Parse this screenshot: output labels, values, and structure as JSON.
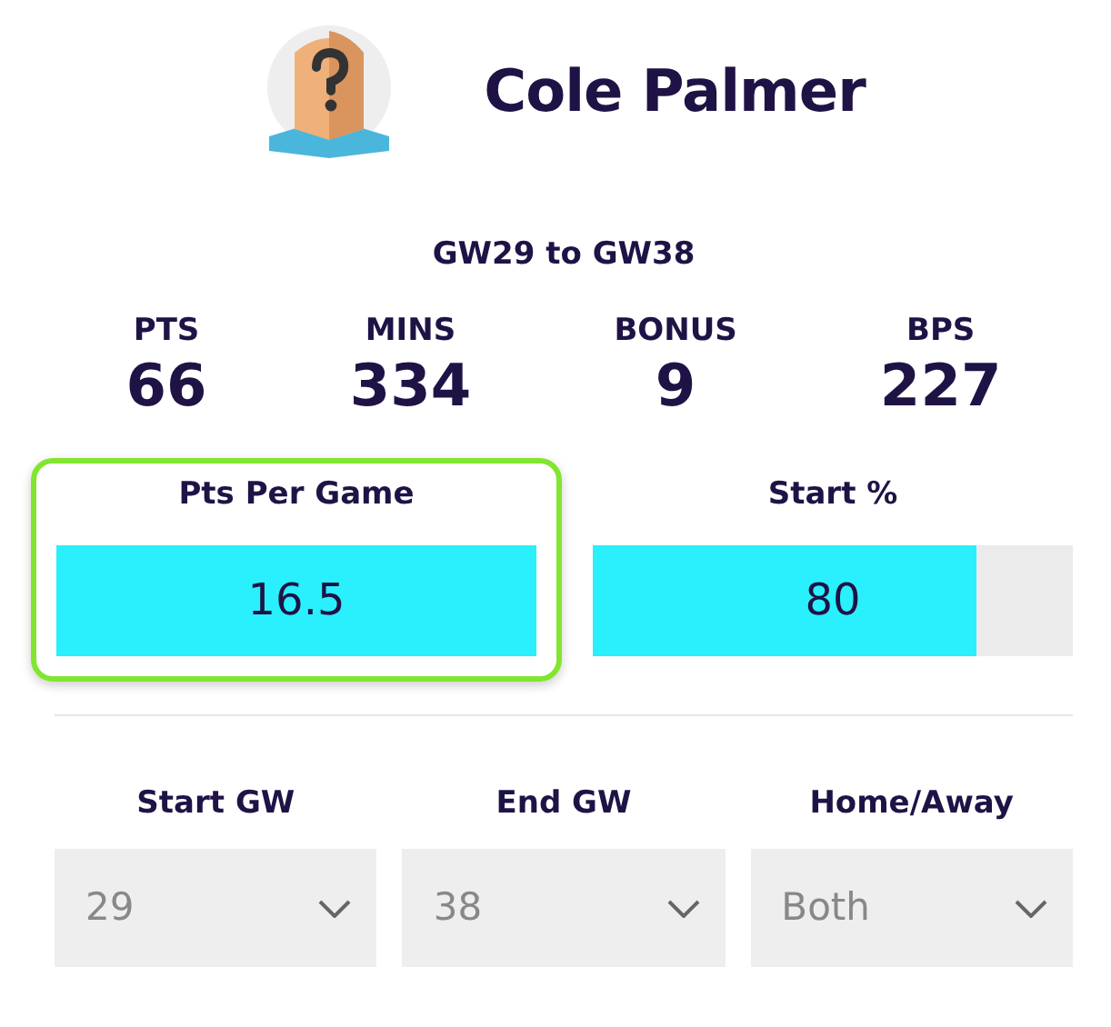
{
  "player": {
    "name": "Cole Palmer"
  },
  "range": "GW29 to GW38",
  "stats": [
    {
      "label": "PTS",
      "value": "66"
    },
    {
      "label": "MINS",
      "value": "334"
    },
    {
      "label": "BONUS",
      "value": "9"
    },
    {
      "label": "BPS",
      "value": "227"
    }
  ],
  "meters": [
    {
      "label": "Pts Per Game",
      "reading": "16.5",
      "level": 1,
      "highlighted": true
    },
    {
      "label": "Start %",
      "reading": "80",
      "level": 0.8,
      "highlighted": false
    }
  ],
  "filters": [
    {
      "label": "Start GW",
      "value": "29"
    },
    {
      "label": "End GW",
      "value": "38"
    },
    {
      "label": "Home/Away",
      "value": "Both"
    }
  ]
}
